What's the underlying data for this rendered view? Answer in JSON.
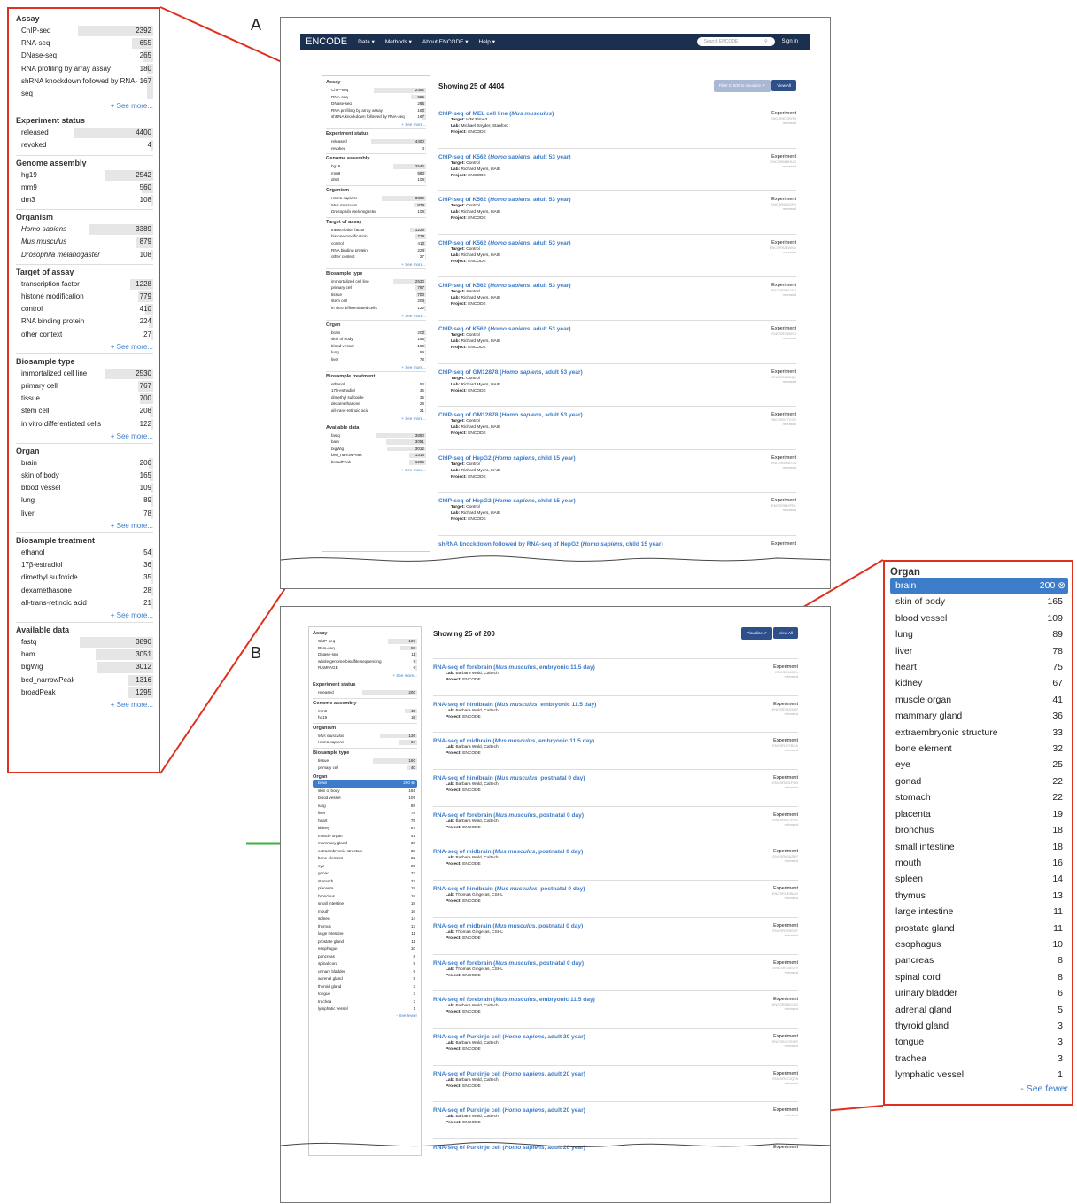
{
  "labels": {
    "a": "A",
    "b": "B"
  },
  "facets_a": [
    {
      "title": "Assay",
      "items": [
        [
          "ChIP-seq",
          "2392",
          0.95
        ],
        [
          "RNA-seq",
          "655",
          0.27
        ],
        [
          "DNase-seq",
          "265",
          0.12
        ],
        [
          "RNA profiling by array assay",
          "180",
          0.08
        ],
        [
          "shRNA knockdown followed by RNA-seq",
          "167",
          0.08
        ]
      ],
      "more": "+ See more..."
    },
    {
      "title": "Experiment status",
      "items": [
        [
          "released",
          "4400",
          1.0
        ],
        [
          "revoked",
          "4",
          0.01
        ]
      ]
    },
    {
      "title": "Genome assembly",
      "items": [
        [
          "hg19",
          "2542",
          0.6
        ],
        [
          "mm9",
          "560",
          0.14
        ],
        [
          "dm3",
          "108",
          0.03
        ]
      ]
    },
    {
      "title": "Organism",
      "italic": true,
      "items": [
        [
          "Homo sapiens",
          "3389",
          0.8
        ],
        [
          "Mus musculus",
          "879",
          0.22
        ],
        [
          "Drosophila melanogaster",
          "108",
          0.03
        ]
      ]
    },
    {
      "title": "Target of assay",
      "items": [
        [
          "transcription factor",
          "1228",
          0.29
        ],
        [
          "histone modification",
          "779",
          0.19
        ],
        [
          "control",
          "410",
          0.1
        ],
        [
          "RNA binding protein",
          "224",
          0.06
        ],
        [
          "other context",
          "27",
          0.01
        ]
      ],
      "more": "+ See more..."
    },
    {
      "title": "Biosample type",
      "items": [
        [
          "immortalized cell line",
          "2530",
          0.6
        ],
        [
          "primary cell",
          "767",
          0.19
        ],
        [
          "tissue",
          "700",
          0.17
        ],
        [
          "stem cell",
          "208",
          0.05
        ],
        [
          "in vitro differentiated cells",
          "122",
          0.03
        ]
      ],
      "more": "+ See more..."
    },
    {
      "title": "Organ",
      "items": [
        [
          "brain",
          "200",
          0.06
        ],
        [
          "skin of body",
          "165",
          0.04
        ],
        [
          "blood vessel",
          "109",
          0.03
        ],
        [
          "lung",
          "89",
          0.02
        ],
        [
          "liver",
          "78",
          0.02
        ]
      ],
      "more": "+ See more..."
    },
    {
      "title": "Biosample treatment",
      "items": [
        [
          "ethanol",
          "54",
          0.02
        ],
        [
          "17β-estradiol",
          "36",
          0.02
        ],
        [
          "dimethyl sulfoxide",
          "35",
          0.01
        ],
        [
          "dexamethasone",
          "28",
          0.01
        ],
        [
          "all-trans-retinoic acid",
          "21",
          0.01
        ]
      ],
      "more": "+ See more..."
    },
    {
      "title": "Available data",
      "items": [
        [
          "fastq",
          "3890",
          0.92
        ],
        [
          "bam",
          "3051",
          0.72
        ],
        [
          "bigWig",
          "3012",
          0.71
        ],
        [
          "bed_narrowPeak",
          "1316",
          0.31
        ],
        [
          "broadPeak",
          "1295",
          0.31
        ]
      ],
      "more": "+ See more..."
    }
  ],
  "nav": {
    "brand": "ENCODE",
    "menus": [
      "Data ▾",
      "Methods ▾",
      "About ENCODE ▾",
      "Help ▾"
    ],
    "search_placeholder": "Search ENCODE",
    "sign_in": "Sign in"
  },
  "results_a": {
    "showing": "Showing 25 of 4404",
    "filter_btn": "Filter to 500 to visualize ⇗",
    "view_all": "View All",
    "items": [
      {
        "pre": "ChIP-seq of MEL cell line (",
        "org": "Mus musculus",
        "post": ")",
        "m1": "Target:",
        "v1": "H3K36me3",
        "lab": "Michael Snyder, Stanford",
        "acc": "ENCSR672KRN"
      },
      {
        "pre": "ChIP-seq of K562 (",
        "org": "Homo sapiens",
        "post": ", adult 53 year)",
        "m1": "Target:",
        "v1": "Control",
        "lab": "Richard Myers, HAIB",
        "acc": "ENCSR868HUG"
      },
      {
        "pre": "ChIP-seq of K562 (",
        "org": "Homo sapiens",
        "post": ", adult 53 year)",
        "m1": "Target:",
        "v1": "Control",
        "lab": "Richard Myers, HAIB",
        "acc": "ENCSR660SFN"
      },
      {
        "pre": "ChIP-seq of K562 (",
        "org": "Homo sapiens",
        "post": ", adult 53 year)",
        "m1": "Target:",
        "v1": "Control",
        "lab": "Richard Myers, HAIB",
        "acc": "ENCSR924WND"
      },
      {
        "pre": "ChIP-seq of K562 (",
        "org": "Homo sapiens",
        "post": ", adult 53 year)",
        "m1": "Target:",
        "v1": "Control",
        "lab": "Richard Myers, HAIB",
        "acc": "ENCSR598JFO"
      },
      {
        "pre": "ChIP-seq of K562 (",
        "org": "Homo sapiens",
        "post": ", adult 53 year)",
        "m1": "Target:",
        "v1": "Control",
        "lab": "Richard Myers, HAIB",
        "acc": "ENCSR330IKO"
      },
      {
        "pre": "ChIP-seq of GM12878 (",
        "org": "Homo sapiens",
        "post": ", adult 53 year)",
        "m1": "Target:",
        "v1": "Control",
        "lab": "Richard Myers, HAIB",
        "acc": "ENCSR063IQV"
      },
      {
        "pre": "ChIP-seq of GM12878 (",
        "org": "Homo sapiens",
        "post": ", adult 53 year)",
        "m1": "Target:",
        "v1": "Control",
        "lab": "Richard Myers, HAIB",
        "acc": "ENCSR037VSG"
      },
      {
        "pre": "ChIP-seq of HepG2 (",
        "org": "Homo sapiens",
        "post": ", child 15 year)",
        "m1": "Target:",
        "v1": "Control",
        "lab": "Richard Myers, HAIB",
        "acc": "ENCSR805LCA"
      },
      {
        "pre": "ChIP-seq of HepG2 (",
        "org": "Homo sapiens",
        "post": ", child 15 year)",
        "m1": "Target:",
        "v1": "Control",
        "lab": "Richard Myers, HAIB",
        "acc": "ENCSR649FPL"
      }
    ],
    "last": {
      "pre": "shRNA knockdown followed by RNA-seq of HepG2 (",
      "org": "Homo sapiens",
      "post": ", child 15 year)"
    },
    "type": "Experiment",
    "status": "released",
    "project_label": "Project:",
    "project": "ENCODE",
    "lab_label": "Lab:"
  },
  "facets_b": [
    {
      "title": "Assay",
      "items": [
        [
          "ChIP-seq",
          "108",
          0.54
        ],
        [
          "RNA-seq",
          "59",
          0.3
        ],
        [
          "DNase-seq",
          "11",
          0.06
        ],
        [
          "whole genome bisulfite sequencing",
          "9",
          0.05
        ],
        [
          "RAMPAGE",
          "6",
          0.03
        ]
      ],
      "more": "+ See more..."
    },
    {
      "title": "Experiment status",
      "items": [
        [
          "released",
          "200",
          1.0
        ]
      ]
    },
    {
      "title": "Genome assembly",
      "items": [
        [
          "mm9",
          "45",
          0.23
        ],
        [
          "hg19",
          "16",
          0.08
        ]
      ]
    },
    {
      "title": "Organism",
      "italic": true,
      "items": [
        [
          "Mus musculus",
          "136",
          0.68
        ],
        [
          "Homo sapiens",
          "64",
          0.32
        ]
      ]
    },
    {
      "title": "Biosample type",
      "items": [
        [
          "tissue",
          "160",
          0.8
        ],
        [
          "primary cell",
          "40",
          0.2
        ]
      ]
    }
  ],
  "organ": {
    "title": "Organ",
    "selected": "brain",
    "selected_count": "200 ⊗",
    "fewer": "- See fewer",
    "items": [
      [
        "skin of body",
        "165"
      ],
      [
        "blood vessel",
        "109"
      ],
      [
        "lung",
        "89"
      ],
      [
        "liver",
        "78"
      ],
      [
        "heart",
        "75"
      ],
      [
        "kidney",
        "67"
      ],
      [
        "muscle organ",
        "41"
      ],
      [
        "mammary gland",
        "36"
      ],
      [
        "extraembryonic structure",
        "33"
      ],
      [
        "bone element",
        "32"
      ],
      [
        "eye",
        "25"
      ],
      [
        "gonad",
        "22"
      ],
      [
        "stomach",
        "22"
      ],
      [
        "placenta",
        "19"
      ],
      [
        "bronchus",
        "18"
      ],
      [
        "small intestine",
        "18"
      ],
      [
        "mouth",
        "16"
      ],
      [
        "spleen",
        "14"
      ],
      [
        "thymus",
        "13"
      ],
      [
        "large intestine",
        "11"
      ],
      [
        "prostate gland",
        "11"
      ],
      [
        "esophagus",
        "10"
      ],
      [
        "pancreas",
        "8"
      ],
      [
        "spinal cord",
        "8"
      ],
      [
        "urinary bladder",
        "6"
      ],
      [
        "adrenal gland",
        "5"
      ],
      [
        "thyroid gland",
        "3"
      ],
      [
        "tongue",
        "3"
      ],
      [
        "trachea",
        "3"
      ],
      [
        "lymphatic vessel",
        "1"
      ]
    ]
  },
  "results_b": {
    "showing": "Showing 25 of 200",
    "visualize_btn": "Visualize ⇗",
    "view_all": "View All",
    "items": [
      {
        "pre": "RNA-seq of forebrain (",
        "org": "Mus musculus",
        "post": ", embryonic 11.5 day)",
        "lab": "Barbara Wold, Caltech",
        "acc": "ENCSR160IIN"
      },
      {
        "pre": "RNA-seq of hindbrain (",
        "org": "Mus musculus",
        "post": ", embryonic 11.5 day)",
        "lab": "Barbara Wold, Caltech",
        "acc": "ENCSR792DOE"
      },
      {
        "pre": "RNA-seq of midbrain (",
        "org": "Mus musculus",
        "post": ", embryonic 11.5 day)",
        "lab": "Barbara Wold, Caltech",
        "acc": "ENCSR307BCA"
      },
      {
        "pre": "RNA-seq of hindbrain (",
        "org": "Mus musculus",
        "post": ", postnatal 0 day)",
        "lab": "Barbara Wold, Caltech",
        "acc": "ENCSR851FGB"
      },
      {
        "pre": "RNA-seq of forebrain (",
        "org": "Mus musculus",
        "post": ", postnatal 0 day)",
        "lab": "Barbara Wold, Caltech",
        "acc": "ENCSR627RFK"
      },
      {
        "pre": "RNA-seq of midbrain (",
        "org": "Mus musculus",
        "post": ", postnatal 0 day)",
        "lab": "Barbara Wold, Caltech",
        "acc": "ENCSR026ZRP"
      },
      {
        "pre": "RNA-seq of hindbrain (",
        "org": "Mus musculus",
        "post": ", postnatal 0 day)",
        "lab": "Thomas Gingeras, CSHL",
        "acc": "ENCSR149BAG"
      },
      {
        "pre": "RNA-seq of midbrain (",
        "org": "Mus musculus",
        "post": ", postnatal 0 day)",
        "lab": "Thomas Gingeras, CSHL",
        "acc": "ENCSR255SDF"
      },
      {
        "pre": "RNA-seq of forebrain (",
        "org": "Mus musculus",
        "post": ", postnatal 0 day)",
        "lab": "Thomas Gingeras, CSHL",
        "acc": "ENCSR105SZV"
      },
      {
        "pre": "RNA-seq of forebrain (",
        "org": "Mus musculus",
        "post": ", embryonic 11.5 day)",
        "lab": "Barbara Wold, Caltech",
        "acc": "ENCSR950OXD"
      },
      {
        "pre": "RNA-seq of Purkinje cell (",
        "org": "Homo sapiens",
        "post": ", adult 20 year)",
        "lab": "Barbara Wold, Caltech",
        "acc": "ENCSR417EOR"
      },
      {
        "pre": "RNA-seq of Purkinje cell (",
        "org": "Homo sapiens",
        "post": ", adult 20 year)",
        "lab": "Barbara Wold, Caltech",
        "acc": "ENCSR672QFA"
      },
      {
        "pre": "RNA-seq of Purkinje cell (",
        "org": "Homo sapiens",
        "post": ", adult 20 year)",
        "lab": "Barbara Wold, Caltech",
        "acc": ""
      }
    ],
    "last": {
      "pre": "RNA-seq of Purkinje cell (",
      "org": "Homo sapiens",
      "post": ", adult 20 year)"
    }
  },
  "colors": {
    "accent": "#3d7cc9",
    "zoom_outline": "#e0301e",
    "navbar": "#1b2f4f",
    "arrow": "#3cb043"
  }
}
